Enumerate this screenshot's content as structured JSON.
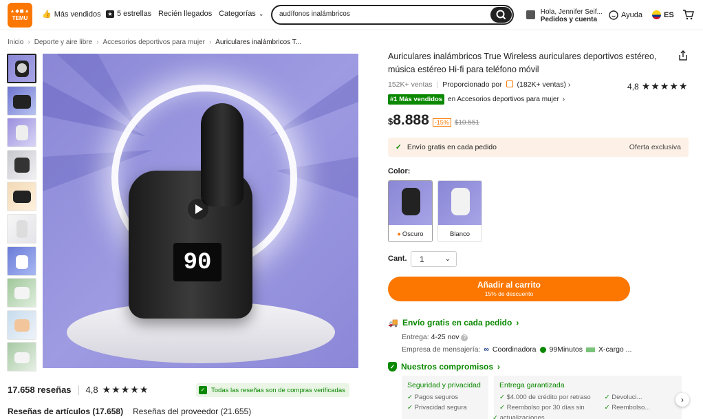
{
  "header": {
    "logo_text": "TEMU",
    "nav": [
      "Más vendidos",
      "5 estrellas",
      "Recién llegados",
      "Categorías"
    ],
    "search_value": "audífonos inalámbricos",
    "account_line1": "Hola, Jennifer Seif...",
    "account_line2": "Pedidos y cuenta",
    "help": "Ayuda",
    "language": "ES"
  },
  "breadcrumb": [
    "Inicio",
    "Deporte y aire libre",
    "Accesorios deportivos para mujer",
    "Auriculares inalámbricos T..."
  ],
  "product": {
    "title": "Auriculares inalámbricos True Wireless auriculares deportivos estéreo, música estéreo Hi-fi para teléfono móvil",
    "sales": "152K+ ventas",
    "provided_by": "Proporcionado por",
    "provider_sales": "(182K+ ventas)",
    "rating": "4,8",
    "stars": "★★★★★",
    "best_tag": "#1 Más vendidos",
    "best_in": "en Accesorios deportivos para mujer",
    "currency": "$",
    "price": "8.888",
    "discount": "-15%",
    "old_price": "$10.551",
    "display_number": "90"
  },
  "shipping_bar": {
    "left": "Envío gratis en cada pedido",
    "right": "Oferta exclusiva"
  },
  "color": {
    "label": "Color:",
    "options": [
      "Oscuro",
      "Blanco"
    ]
  },
  "quantity": {
    "label": "Cant.",
    "value": "1"
  },
  "cart": {
    "label": "Añadir al carrito",
    "sub": "15% de descuento"
  },
  "delivery": {
    "free_ship": "Envío gratis en cada pedido",
    "label": "Entrega:",
    "dates": "4-25 nov",
    "courier_label": "Empresa de mensajería:",
    "couriers": [
      "Coordinadora",
      "99Minutos",
      "X-cargo ..."
    ]
  },
  "commitments": {
    "title": "Nuestros compromisos",
    "panels": [
      {
        "heading": "Seguridad y privacidad",
        "items": [
          "Pagos seguros",
          "Privacidad segura"
        ]
      },
      {
        "heading": "Entrega garantizada",
        "items": [
          "$4.000 de crédito por retraso",
          "Reembolso por 30 días sin",
          "actualizaciones"
        ]
      },
      {
        "heading": "",
        "items": [
          "Devoluci...",
          "Reembolso..."
        ]
      }
    ]
  },
  "reviews": {
    "count": "17.658 reseñas",
    "rating": "4,8",
    "stars": "★★★★★",
    "verified": "Todas las reseñas son de compras verificadas",
    "tab_items": "Reseñas de artículos (17.658)",
    "tab_store": "Reseñas del proveedor (21.655)"
  },
  "colors": {
    "brand": "#fb7701",
    "green": "#0a8800"
  }
}
